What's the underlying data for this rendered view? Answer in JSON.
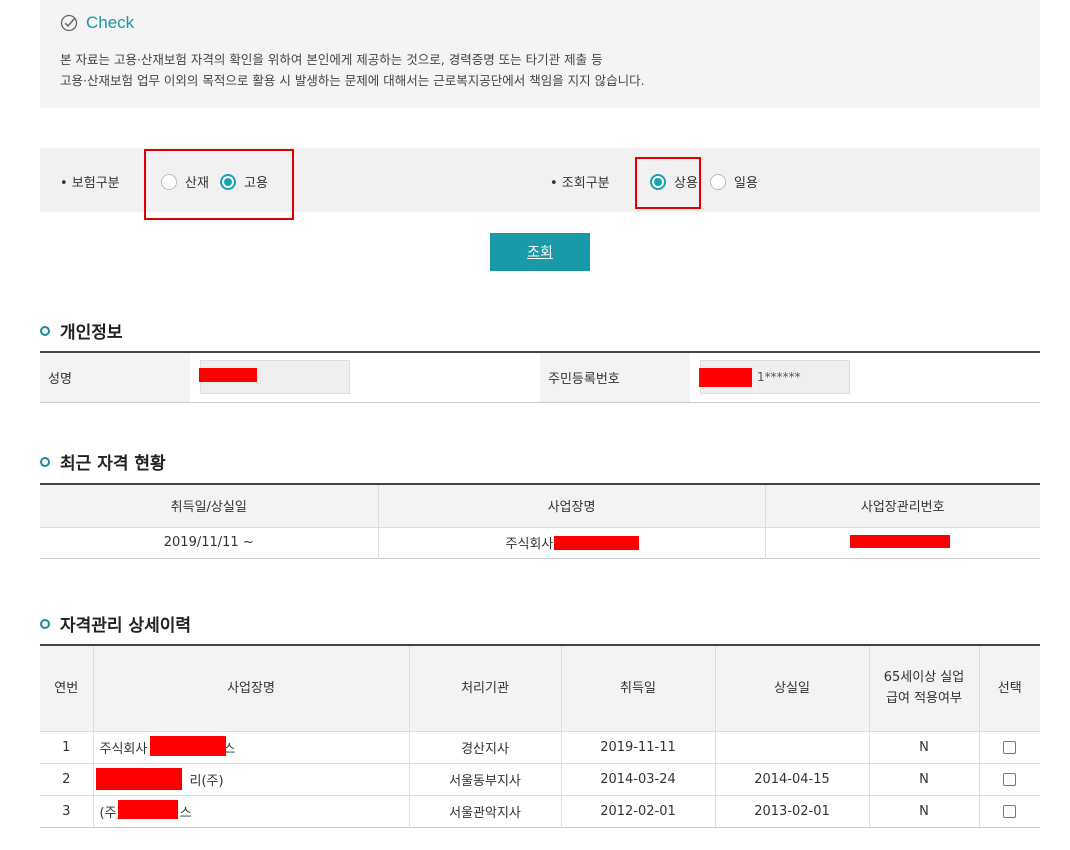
{
  "notice": {
    "title": "Check",
    "line1": "본 자료는 고용·산재보험 자격의 확인을 위하여 본인에게 제공하는 것으로, 경력증명 또는 타기관 제출 등",
    "line2": "고용·산재보험 업무 이외의 목적으로 활용 시 발생하는 문제에 대해서는 근로복지공단에서 책임을 지지 않습니다."
  },
  "filters": {
    "insurance_label": "• 보험구분",
    "insurance_options": [
      {
        "label": "산재",
        "selected": false
      },
      {
        "label": "고용",
        "selected": true
      }
    ],
    "query_label": "• 조회구분",
    "query_options": [
      {
        "label": "상용",
        "selected": true
      },
      {
        "label": "일용",
        "selected": false
      }
    ]
  },
  "search_button": "조회",
  "personal": {
    "title": "개인정보",
    "name_label": "성명",
    "name_value": "",
    "rrn_label": "주민등록번호",
    "rrn_value": "1******"
  },
  "status": {
    "title": "최근 자격 현황",
    "headers": [
      "취득일/상실일",
      "사업장명",
      "사업장관리번호"
    ],
    "row": {
      "date": "2019/11/11 ~",
      "company": "주식회사",
      "mgmt_no": ""
    }
  },
  "detail": {
    "title": "자격관리 상세이력",
    "headers": {
      "no": "연번",
      "company": "사업장명",
      "office": "처리기관",
      "acquired": "취득일",
      "lost": "상실일",
      "over65": "65세이상 실업급여 적용여부",
      "select": "선택"
    },
    "rows": [
      {
        "no": "1",
        "company": "주식회사",
        "company_suffix": "스",
        "office": "경산지사",
        "acquired": "2019-11-11",
        "lost": "",
        "over65": "N"
      },
      {
        "no": "2",
        "company": "",
        "company_suffix": "리(주)",
        "office": "서울동부지사",
        "acquired": "2014-03-24",
        "lost": "2014-04-15",
        "over65": "N"
      },
      {
        "no": "3",
        "company": "(주)",
        "company_suffix": "스",
        "office": "서울관악지사",
        "acquired": "2012-02-01",
        "lost": "2013-02-01",
        "over65": "N"
      }
    ]
  },
  "colors": {
    "accent": "#1a9aa8",
    "highlight": "#e00000",
    "redaction": "#ff0000"
  }
}
